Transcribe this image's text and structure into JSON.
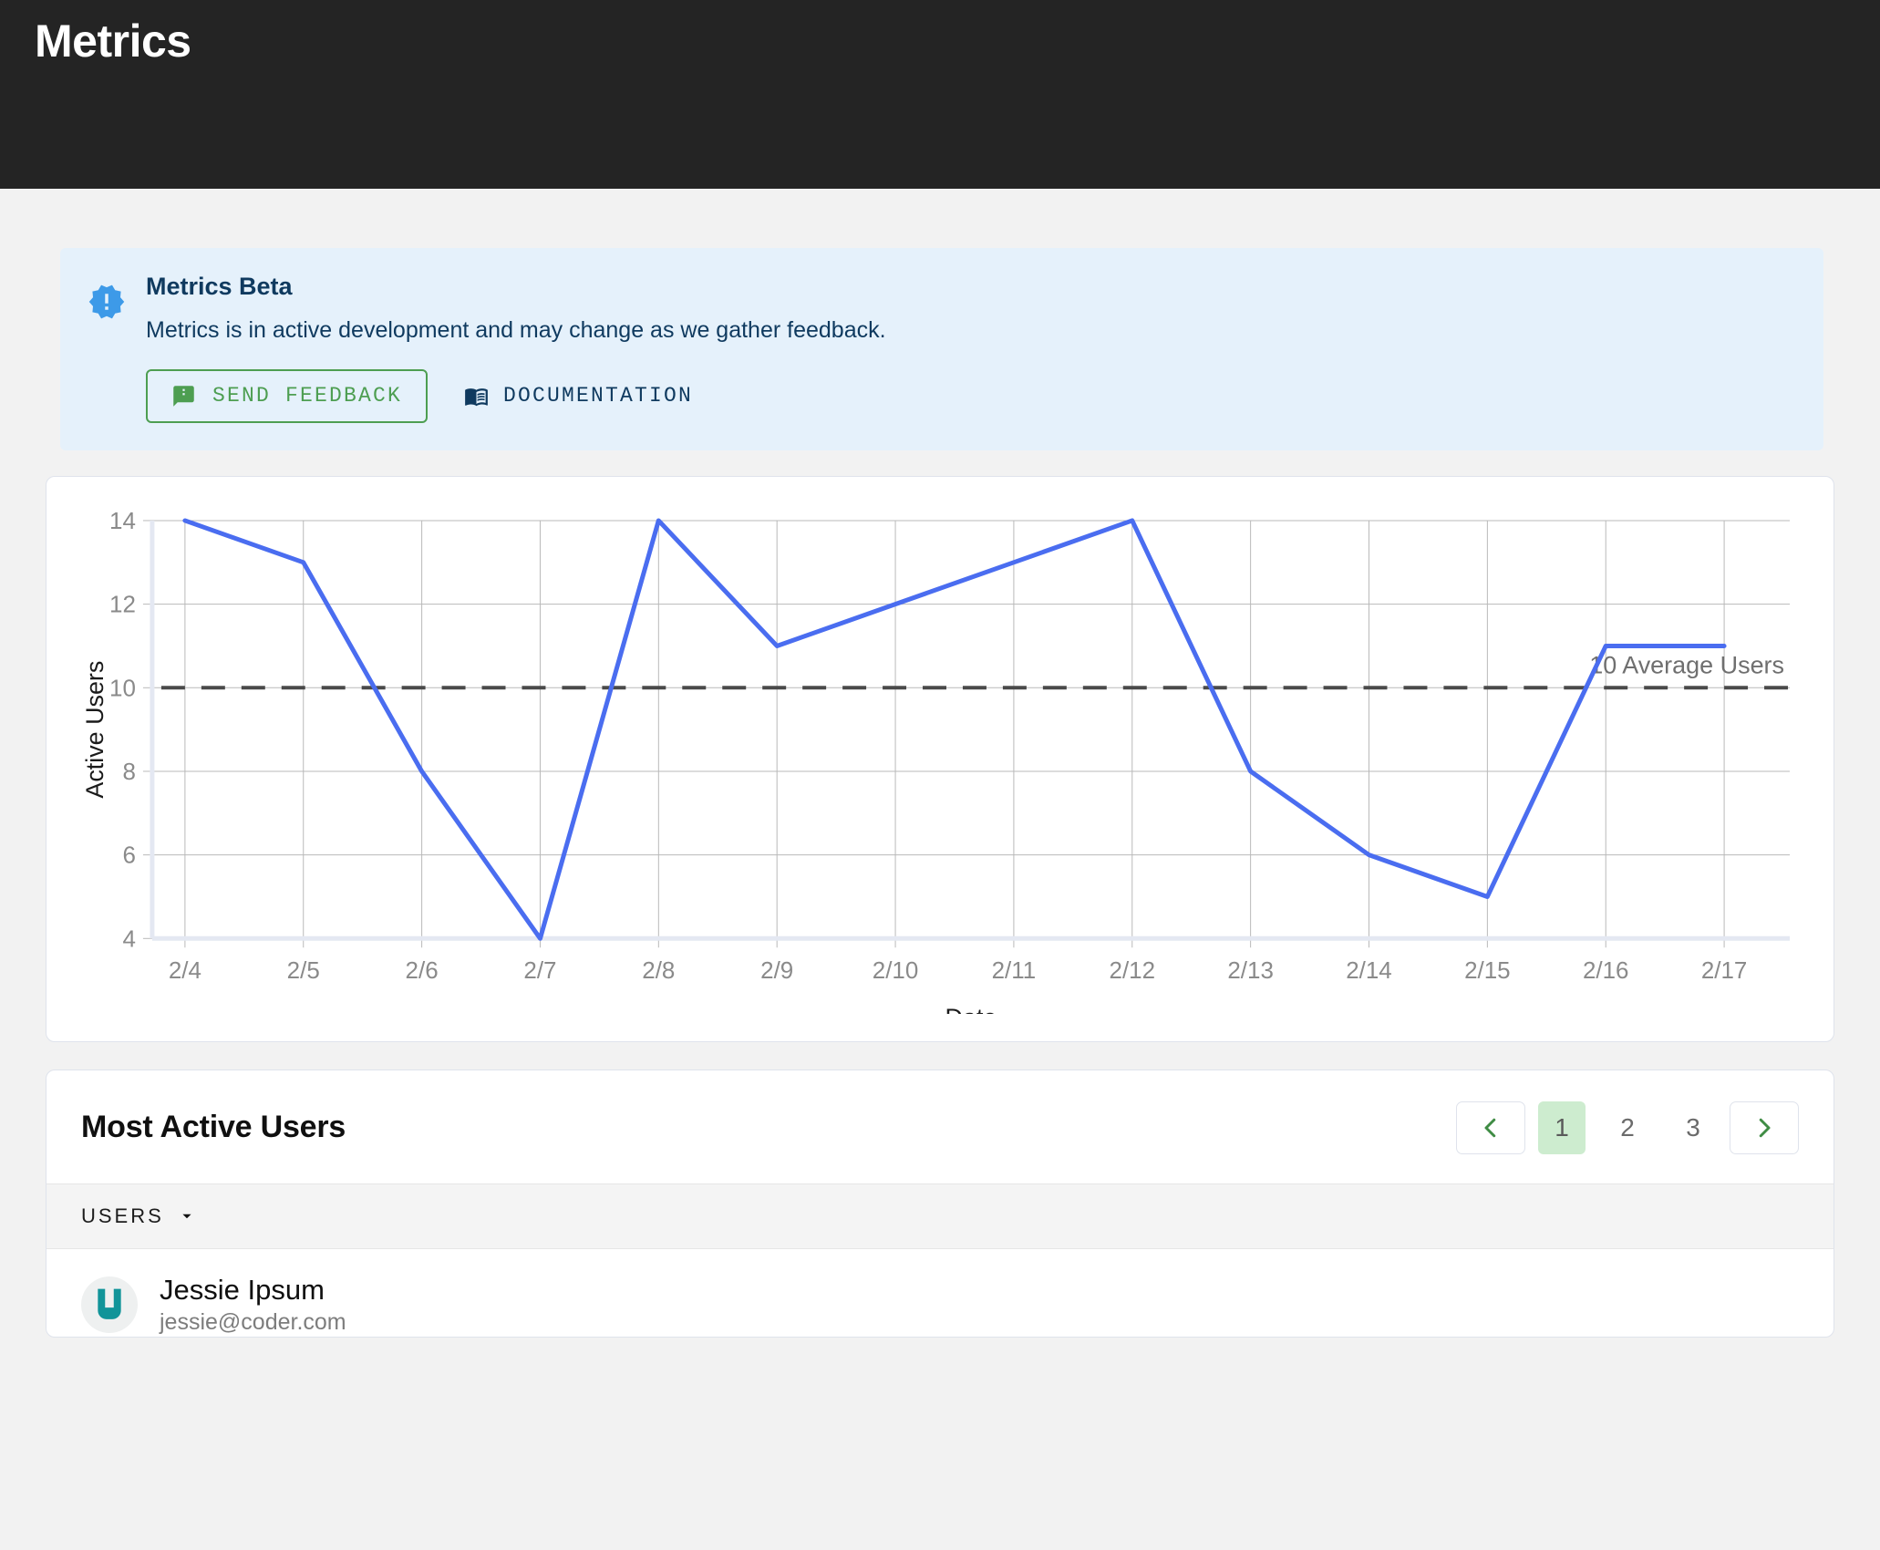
{
  "header": {
    "title": "Metrics"
  },
  "banner": {
    "icon": "new-releases-icon",
    "title": "Metrics Beta",
    "description": "Metrics is in active development and may change as we gather feedback.",
    "feedback_button": {
      "label": "SEND FEEDBACK",
      "icon": "feedback-icon",
      "color": "#4d9e51"
    },
    "documentation_link": {
      "label": "DOCUMENTATION",
      "icon": "book-icon",
      "color": "#0f3a5f"
    },
    "background": "#e5f1fb",
    "text_color": "#0f3a5f"
  },
  "chart_data": {
    "type": "line",
    "title": "",
    "xlabel": "Date",
    "ylabel": "Active Users",
    "categories": [
      "2/4",
      "2/5",
      "2/6",
      "2/7",
      "2/8",
      "2/9",
      "2/10",
      "2/11",
      "2/12",
      "2/13",
      "2/14",
      "2/15",
      "2/16",
      "2/17"
    ],
    "series": [
      {
        "name": "Active Users",
        "color": "#4a6df0",
        "values": [
          14,
          13,
          8,
          4,
          14,
          11,
          12,
          13,
          14,
          8,
          6,
          5,
          11,
          11
        ]
      }
    ],
    "reference_line": {
      "value": 10,
      "label": "10 Average Users",
      "style": "dashed",
      "color": "#4a4a4a"
    },
    "ylim": [
      4,
      14
    ],
    "yticks": [
      4,
      6,
      8,
      10,
      12,
      14
    ],
    "grid": true,
    "legend": "none"
  },
  "users_panel": {
    "title": "Most Active Users",
    "column_header": "USERS",
    "sort_icon": "chevron-down-icon",
    "pagination": {
      "prev_icon": "chevron-left-icon",
      "next_icon": "chevron-right-icon",
      "pages": [
        "1",
        "2",
        "3"
      ],
      "current": "1",
      "active_background": "#cdeccf",
      "arrow_color": "#3f8c44"
    },
    "rows": [
      {
        "avatar": "coder-logo-avatar",
        "name": "Jessie Ipsum",
        "email": "jessie@coder.com"
      }
    ]
  }
}
